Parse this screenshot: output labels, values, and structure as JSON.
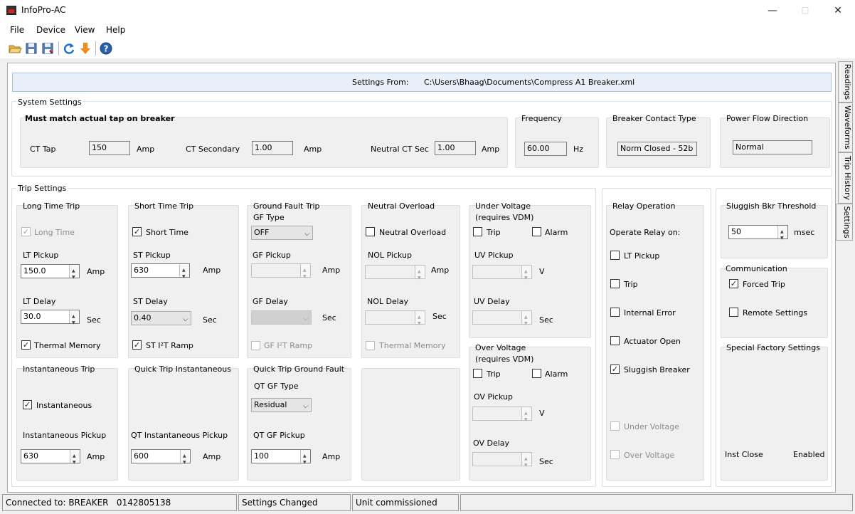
{
  "window": {
    "title": "InfoPro-AC",
    "min": "—",
    "max": "☐",
    "close": "✕"
  },
  "menu": [
    "File",
    "Device",
    "View",
    "Help"
  ],
  "toolbar": [
    "open-folder-icon",
    "save-icon",
    "save-all-icon",
    "refresh-icon",
    "download-icon",
    "help-icon"
  ],
  "settings_from": {
    "label": "Settings From:",
    "path": "C:\\Users\\Bhaag\\Documents\\Compress A1 Breaker.xml"
  },
  "system": {
    "title": "System Settings",
    "tap_title": "Must match actual tap on breaker",
    "ct_tap": {
      "label": "CT Tap",
      "value": "150",
      "unit": "Amp"
    },
    "ct_secondary": {
      "label": "CT Secondary",
      "value": "1.00",
      "unit": "Amp"
    },
    "neutral_ct": {
      "label": "Neutral CT Sec",
      "value": "1.00",
      "unit": "Amp"
    },
    "frequency": {
      "title": "Frequency",
      "value": "60.00",
      "unit": "Hz"
    },
    "contact": {
      "title": "Breaker Contact Type",
      "value": "Norm Closed - 52b"
    },
    "power": {
      "title": "Power Flow Direction",
      "value": "Normal"
    }
  },
  "trip": {
    "title": "Trip Settings",
    "lt": {
      "title": "Long Time Trip",
      "enable": "Long Time",
      "pickup_label": "LT Pickup",
      "pickup": "150.0",
      "pickup_unit": "Amp",
      "delay_label": "LT Delay",
      "delay": "30.0",
      "delay_unit": "Sec",
      "thermal": "Thermal Memory"
    },
    "st": {
      "title": "Short Time Trip",
      "enable": "Short Time",
      "pickup_label": "ST Pickup",
      "pickup": "630",
      "pickup_unit": "Amp",
      "delay_label": "ST Delay",
      "delay": "0.40",
      "delay_unit": "Sec",
      "ramp": "ST I²T Ramp"
    },
    "gf": {
      "title": "Ground Fault Trip",
      "type_label": "GF Type",
      "type": "OFF",
      "pickup_label": "GF Pickup",
      "pickup_unit": "Amp",
      "delay_label": "GF Delay",
      "delay_unit": "Sec",
      "ramp": "GF I²T Ramp"
    },
    "nol": {
      "title": "Neutral Overload",
      "enable": "Neutral Overload",
      "pickup_label": "NOL Pickup",
      "pickup_unit": "Amp",
      "delay_label": "NOL Delay",
      "delay_unit": "Sec",
      "thermal": "Thermal Memory"
    },
    "uv": {
      "title": "Under Voltage",
      "sub": "(requires VDM)",
      "trip": "Trip",
      "alarm": "Alarm",
      "pickup_label": "UV Pickup",
      "pickup_unit": "V",
      "delay_label": "UV Delay",
      "delay_unit": "Sec"
    },
    "ov": {
      "title": "Over Voltage",
      "sub": "(requires VDM)",
      "trip": "Trip",
      "alarm": "Alarm",
      "pickup_label": "OV Pickup",
      "pickup_unit": "V",
      "delay_label": "OV Delay",
      "delay_unit": "Sec"
    },
    "inst": {
      "title": "Instantaneous Trip",
      "enable": "Instantaneous",
      "pickup_label": "Instantaneous Pickup",
      "pickup": "630",
      "unit": "Amp"
    },
    "qti": {
      "title": "Quick Trip Instantaneous",
      "pickup_label": "QT Instantaneous Pickup",
      "pickup": "600",
      "unit": "Amp"
    },
    "qtgf": {
      "title": "Quick Trip Ground Fault",
      "type_label": "QT GF Type",
      "type": "Residual",
      "pickup_label": "QT GF Pickup",
      "pickup": "100",
      "unit": "Amp"
    }
  },
  "relay": {
    "title": "Relay Operation",
    "sub": "Operate Relay on:",
    "items": [
      "LT Pickup",
      "Trip",
      "Internal Error",
      "Actuator Open",
      "Sluggish Breaker",
      "Under Voltage",
      "Over Voltage"
    ]
  },
  "sluggish": {
    "title": "Sluggish Bkr Threshold",
    "value": "50",
    "unit": "msec"
  },
  "comm": {
    "title": "Communication",
    "forced": "Forced Trip",
    "remote": "Remote Settings"
  },
  "factory": {
    "title": "Special Factory Settings",
    "label": "Inst Close",
    "value": "Enabled"
  },
  "tabs": [
    "Readings",
    "Waveforms",
    "Trip History",
    "Settings"
  ],
  "status": {
    "connected": "Connected to: BREAKER   0142805138",
    "changed": "Settings Changed",
    "commissioned": "Unit commissioned"
  }
}
